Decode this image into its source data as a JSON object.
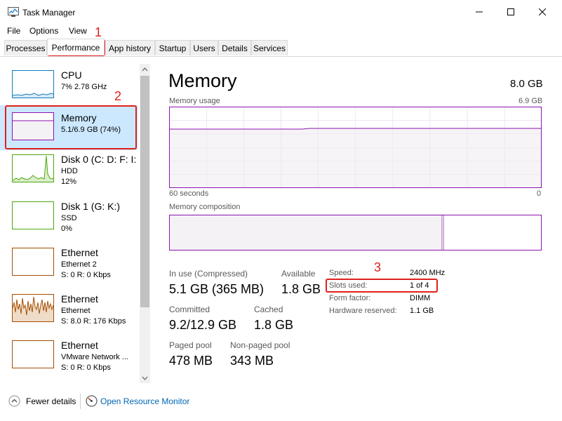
{
  "window": {
    "title": "Task Manager"
  },
  "menu": [
    "File",
    "Options",
    "View"
  ],
  "tabs": [
    "Processes",
    "Performance",
    "App history",
    "Startup",
    "Users",
    "Details",
    "Services"
  ],
  "sidebar": {
    "items": [
      {
        "name": "CPU",
        "sub1": "7% 2.78 GHz",
        "sub2": ""
      },
      {
        "name": "Memory",
        "sub1": "5.1/6.9 GB (74%)",
        "sub2": ""
      },
      {
        "name": "Disk 0 (C: D: F: I:",
        "sub1": "HDD",
        "sub2": "12%"
      },
      {
        "name": "Disk 1 (G: K:)",
        "sub1": "SSD",
        "sub2": "0%"
      },
      {
        "name": "Ethernet",
        "sub1": "Ethernet 2",
        "sub2": "S: 0 R: 0 Kbps"
      },
      {
        "name": "Ethernet",
        "sub1": "Ethernet",
        "sub2": "S: 8.0 R: 176 Kbps"
      },
      {
        "name": "Ethernet",
        "sub1": "VMware Network ...",
        "sub2": "S: 0 R: 0 Kbps"
      }
    ]
  },
  "main": {
    "title": "Memory",
    "total": "8.0 GB",
    "usage_label": "Memory usage",
    "usage_max": "6.9 GB",
    "time_left": "60 seconds",
    "time_right": "0",
    "composition_label": "Memory composition",
    "stats": {
      "in_use_label": "In use (Compressed)",
      "in_use_value": "5.1 GB (365 MB)",
      "available_label": "Available",
      "available_value": "1.8 GB",
      "committed_label": "Committed",
      "committed_value": "9.2/12.9 GB",
      "cached_label": "Cached",
      "cached_value": "1.8 GB",
      "paged_label": "Paged pool",
      "paged_value": "478 MB",
      "nonpaged_label": "Non-paged pool",
      "nonpaged_value": "343 MB"
    },
    "hardware": {
      "speed_label": "Speed:",
      "speed_value": "2400 MHz",
      "slots_label": "Slots used:",
      "slots_value": "1 of 4",
      "form_label": "Form factor:",
      "form_value": "DIMM",
      "reserved_label": "Hardware reserved:",
      "reserved_value": "1.1 GB"
    }
  },
  "footer": {
    "fewer": "Fewer details",
    "resource_monitor": "Open Resource Monitor"
  },
  "annotations": [
    "1",
    "2",
    "3"
  ],
  "colors": {
    "memory": "#8b12ae",
    "disk": "#4da60c",
    "ethernet": "#a74f01",
    "cpu": "#117dbb",
    "highlight": "#e0201b",
    "selected": "#cce8ff"
  }
}
